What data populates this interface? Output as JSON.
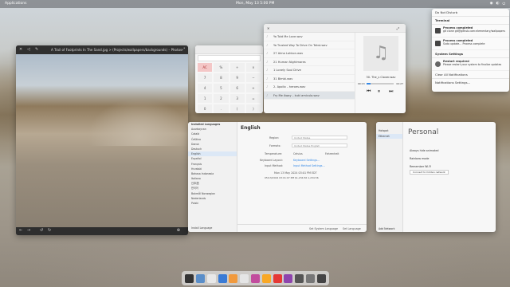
{
  "topbar": {
    "app_name": "Applications",
    "clock": "Mon, May 13 5:00 PM"
  },
  "photo_window": {
    "title": "A Trail of Footprints In The Sand.jpg > (Projects/wallpapers/backgrounds) – Photos"
  },
  "calculator": {
    "buttons": [
      "AC",
      "%",
      "÷",
      "×",
      "7",
      "8",
      "9",
      "−",
      "4",
      "5",
      "6",
      "+",
      "1",
      "2",
      "3",
      "=",
      "0",
      ".",
      "(",
      ")"
    ]
  },
  "music": {
    "tracks": [
      "Ya Told Me Love.wav",
      "Ya Trusted Way To Drive On Tekst.wav",
      "27 Alma Lohkon.wav",
      "21 Human Nightmares",
      "1 Lonely Soul Drive",
      "31 Bimbi.wav",
      "2. Apollo – heroes.wav",
      "Fry Me Away – kuki amicula.wav"
    ],
    "now_playing": "30. The_s Clover.wav",
    "time_elapsed": "00:13",
    "time_total": "02:27",
    "art_icon": "music-note-icon"
  },
  "notifications": {
    "dnd_label": "Do Not Disturb",
    "section_terminal": "Terminal",
    "items": [
      {
        "title": "Process completed",
        "body": "git clone git@github.com:elementary/wallpapers",
        "time": "Now"
      },
      {
        "title": "Process completed",
        "body": "Sudo update… Process complete",
        "time": "Just now"
      }
    ],
    "section_settings": "System Settings",
    "settings_item": {
      "title": "Restart required",
      "body": "Please restart your system to finalize updates",
      "time": "5m ago"
    },
    "clear_label": "Clear All Notifications",
    "settings_label": "Notifications Settings…"
  },
  "language_window": {
    "sidebar_title": "Installed Languages",
    "languages": [
      "Azərbaycan",
      "Català",
      "Čeština",
      "Dansk",
      "Deutsch",
      "English",
      "Español",
      "Français",
      "Hrvatski",
      "Bahasa Indonesia",
      "Italiano",
      "日本語",
      "한국어",
      "Bokmål Norwegian",
      "Nederlands",
      "Polski"
    ],
    "selected": "English",
    "heading": "English",
    "region_label": "Region:",
    "region_value": "United States",
    "formats_label": "Formats:",
    "formats_value": "United States English",
    "temperature_label": "Temperature:",
    "celsius": "Celsius",
    "fahrenheit": "Fahrenheit",
    "keyboard_label": "Keyboard Layout:",
    "keyboard_value": "Keyboard Settings…",
    "input_label": "Input Method:",
    "input_value": "Input Method Settings…",
    "sample_date": "Mon 13 May 2024 03:01 PM EDT",
    "sample_number": "05/13/2024 03:01:07 PM  $1,234.56  1,234.56",
    "add_label": "Install Language",
    "set_system_label": "Set System Language",
    "apply_label": "Set Language"
  },
  "personal_window": {
    "title": "Personal",
    "sidebar_header": "Hotspot",
    "sidebar_item": "Ethernet",
    "options": [
      "Always hide animated",
      "Rainbow mode",
      "Remember Wi-Fi"
    ],
    "button_label": "Connect to hidden network",
    "add_label": "Add Network"
  },
  "dock": {
    "apps": [
      {
        "name": "terminal-icon",
        "color": "#333"
      },
      {
        "name": "files-icon",
        "color": "#5a8ec9"
      },
      {
        "name": "mail-icon",
        "color": "#e8e8e8"
      },
      {
        "name": "browser-icon",
        "color": "#3a7bd5"
      },
      {
        "name": "photos-icon",
        "color": "#f19a3e"
      },
      {
        "name": "calendar-icon",
        "color": "#e5e5e5"
      },
      {
        "name": "tasks-icon",
        "color": "#c24d9d"
      },
      {
        "name": "music-icon",
        "color": "#f9a825"
      },
      {
        "name": "videos-icon",
        "color": "#e53935"
      },
      {
        "name": "appcenter-icon",
        "color": "#8e44ad"
      },
      {
        "name": "settings-icon",
        "color": "#555"
      },
      {
        "name": "calculator-icon",
        "color": "#777"
      },
      {
        "name": "screenshot-icon",
        "color": "#444"
      }
    ]
  }
}
